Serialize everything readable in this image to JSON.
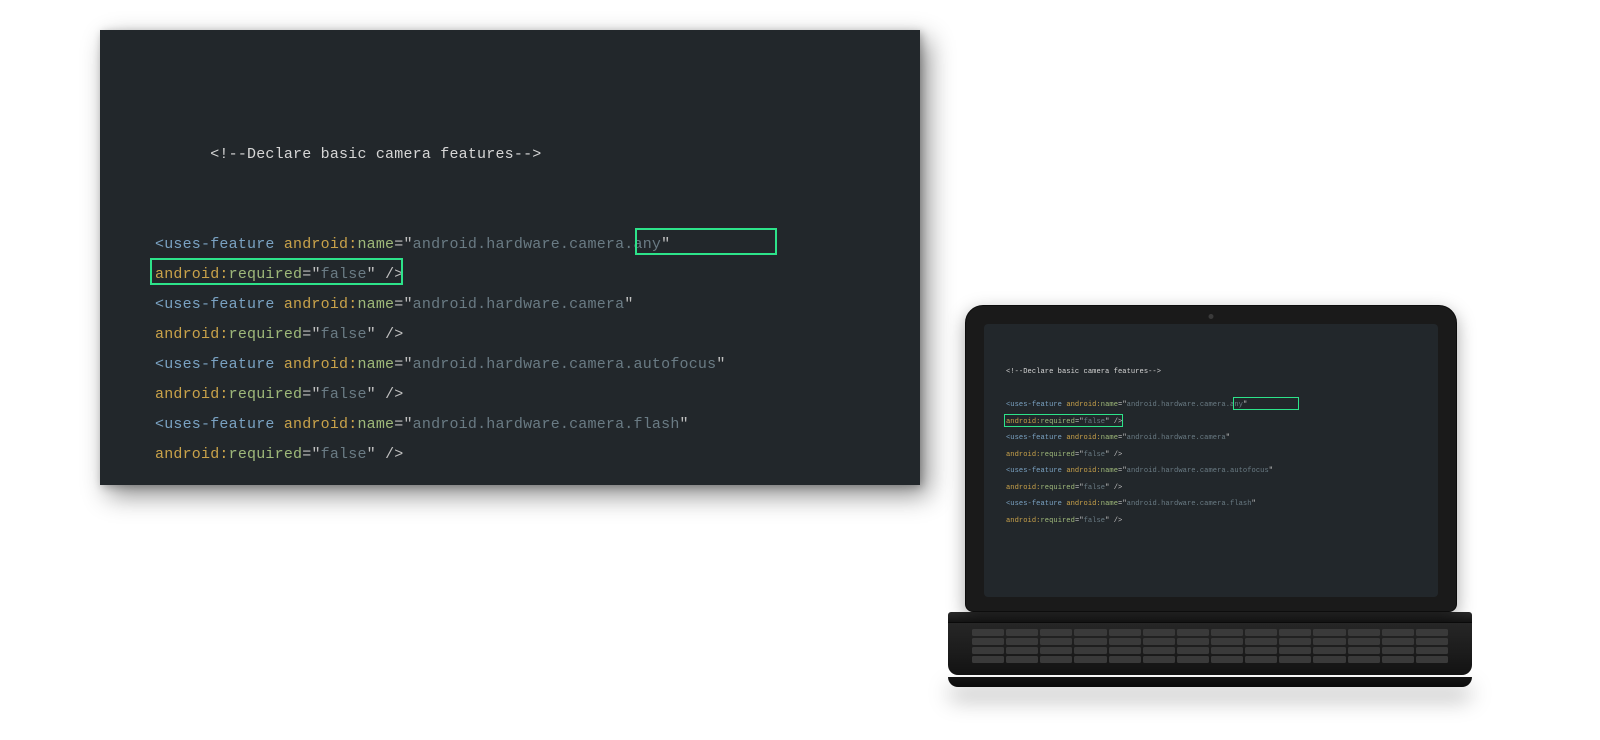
{
  "code": {
    "comment": "<!--Declare basic camera features-->",
    "l1a": "<uses-feature",
    "l1b": "android:",
    "l1c": "name",
    "l1d": "=\"",
    "l1e": "android.hardware.camera.any",
    "l1f": "\"",
    "l2a": "android:",
    "l2b": "required",
    "l2c": "=\"",
    "l2d": "false",
    "l2e": "\" />",
    "l3e": "android.hardware.camera",
    "l5e": "android.hardware.camera.autofocus",
    "l7e": "android.hardware.camera.flash"
  },
  "highlight": {
    "box1_text": ".camera.any\"",
    "box2_text": "android:required=\"false\" />"
  }
}
